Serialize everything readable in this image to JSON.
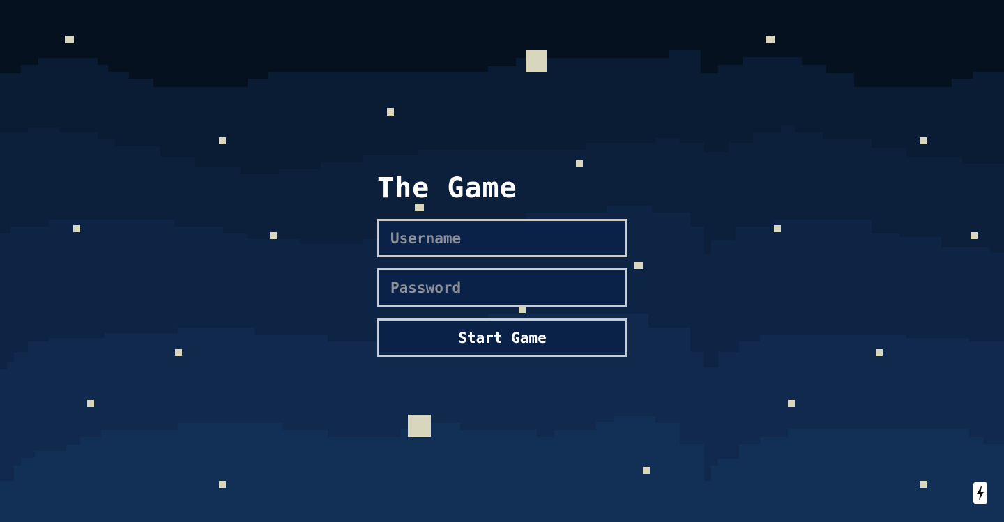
{
  "game": {
    "title": "The Game",
    "username_placeholder": "Username",
    "password_placeholder": "Password",
    "start_label": "Start Game"
  },
  "colors": {
    "sky_top": "#061120",
    "band_1": "#0a1c33",
    "band_2": "#0c1f3b",
    "band_3": "#0e2444",
    "band_4": "#10294d",
    "band_5": "#123056",
    "star": "#d8d6bc",
    "panel_border": "#c9cbcf",
    "panel_fill": "#0b2248"
  },
  "badge": {
    "icon": "lightning-bolt-icon"
  }
}
